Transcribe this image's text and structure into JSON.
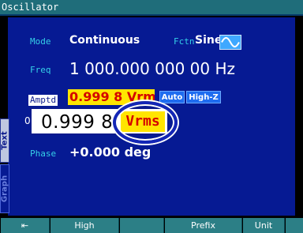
{
  "window": {
    "title": "Oscillator"
  },
  "mode": {
    "label": "Mode",
    "value": "Continuous"
  },
  "fctn": {
    "label": "Fctn",
    "value": "Sine",
    "icon": "sine-wave-icon"
  },
  "freq": {
    "label": "Freq",
    "value": "1 000.000 000 00 Hz"
  },
  "amptd": {
    "label": "Amptd",
    "value": "0.999 8 Vrms",
    "auto_label": "Auto",
    "highz_label": "High-Z"
  },
  "zoom": {
    "prefix_digit": "0",
    "number": "0.999 8",
    "unit": "Vrms"
  },
  "phase": {
    "label": "Phase",
    "value": "+0.000 deg"
  },
  "side_tabs": {
    "text": "Text",
    "graph": "Graph"
  },
  "softkeys": [
    {
      "label": "⇤",
      "name": "back-softkey"
    },
    {
      "label": "High",
      "name": "high-softkey"
    },
    {
      "label": "",
      "name": "blank-softkey"
    },
    {
      "label": "Prefix",
      "name": "prefix-softkey"
    },
    {
      "label": "Unit",
      "name": "unit-softkey"
    },
    {
      "label": "",
      "name": "blank-softkey-2"
    }
  ],
  "colors": {
    "panel": "#061a93",
    "label": "#35d0e8",
    "highlight": "#ffe500",
    "highlight_text": "#d40000",
    "softkey": "#2c7f86"
  }
}
